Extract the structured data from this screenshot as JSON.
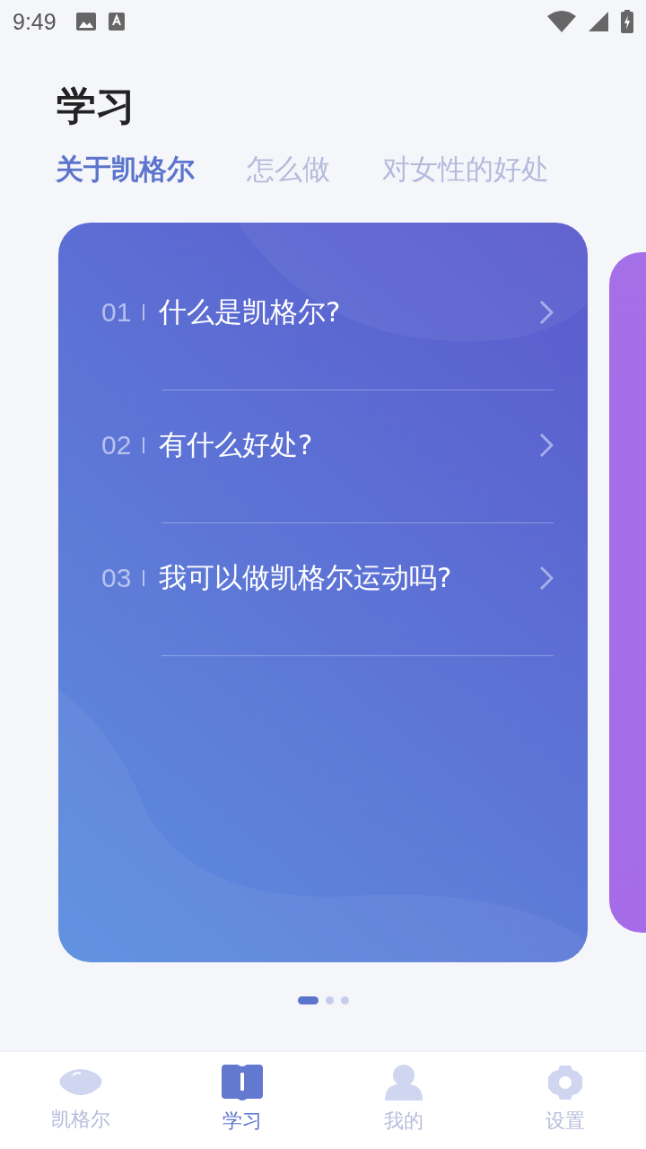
{
  "status_bar": {
    "time": "9:49"
  },
  "title": "学习",
  "tabs": [
    {
      "label": "关于凯格尔",
      "selected": true
    },
    {
      "label": "怎么做",
      "selected": false
    },
    {
      "label": "对女性的好处",
      "selected": false
    }
  ],
  "questions": [
    {
      "number": "01",
      "text": "什么是凯格尔?"
    },
    {
      "number": "02",
      "text": "有什么好处?"
    },
    {
      "number": "03",
      "text": "我可以做凯格尔运动吗?"
    }
  ],
  "pager": [
    {
      "selected": true
    },
    {
      "selected": false
    },
    {
      "selected": false
    }
  ],
  "nav": [
    {
      "kind": "pebble",
      "label": "凯格尔",
      "selected": false
    },
    {
      "kind": "book",
      "label": "学习",
      "selected": true
    },
    {
      "kind": "person",
      "label": "我的",
      "selected": false
    },
    {
      "kind": "gear",
      "label": "设置",
      "selected": false
    }
  ]
}
